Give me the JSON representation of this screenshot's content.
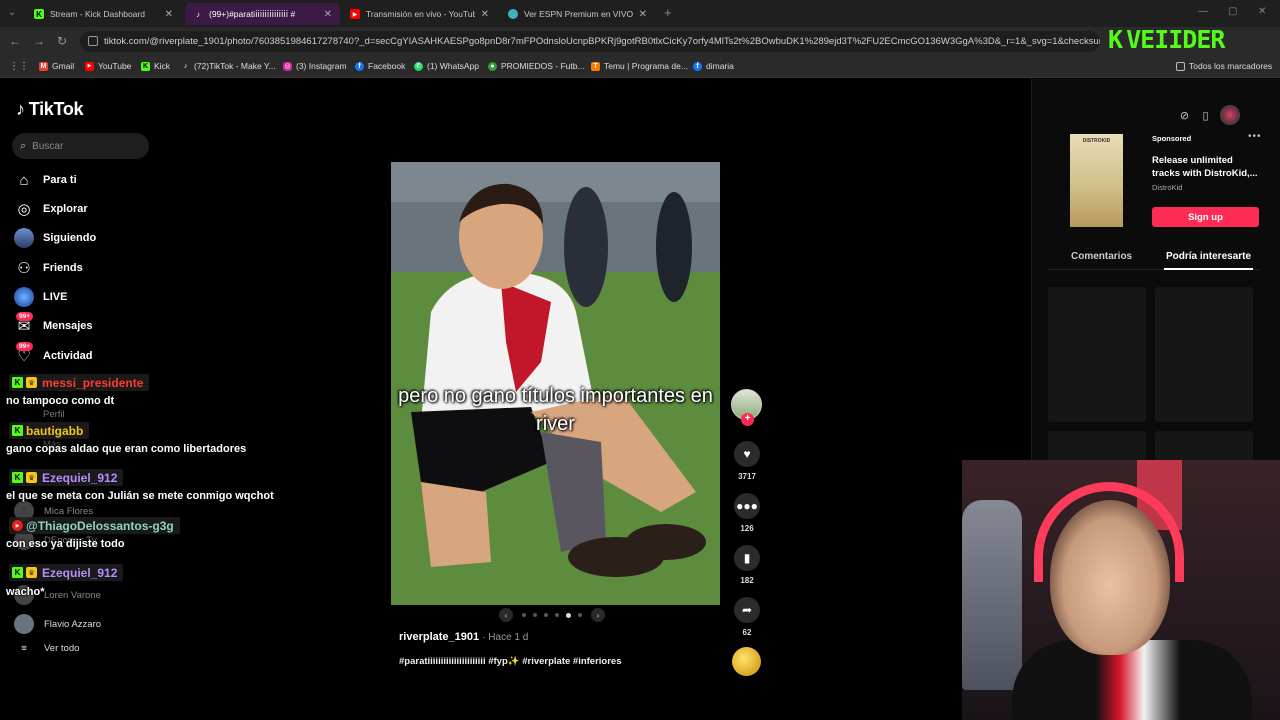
{
  "browser": {
    "tabs": [
      {
        "title": "Stream - Kick Dashboard",
        "icon": "kick-icon",
        "color": "#53fc18"
      },
      {
        "title": "(99+)#parati𝗂𝗂𝗂𝗂𝗂𝗂𝗂𝗂𝗂𝗂𝗂𝗂𝗂𝗂 #",
        "icon": "tiktok-icon",
        "color": "#ffffff"
      },
      {
        "title": "Transmisión en vivo - YouTube",
        "icon": "youtube-icon",
        "color": "#ff0000"
      },
      {
        "title": "Ver ESPN Premium en VIVO Gr",
        "icon": "globe-icon",
        "color": "#3fb1c1"
      }
    ],
    "url": "tiktok.com/@riverplate_1901/photo/7603851984617278740?_d=secCgYIASAHKAESPgo8pnD8r7mFPOdnsloUcnpBPKRj9gotRB0tlxCicKy7orfy4MlTs2t%2BOwbuDK1%289ejd3T%2FU2ECmcGO136W3GgA%3D&_r=1&_svg=1&checksum=c...",
    "bookmarks": [
      {
        "label": "Gmail",
        "icon": "gmail-icon",
        "color": "#ea4335"
      },
      {
        "label": "YouTube",
        "icon": "youtube-icon",
        "color": "#ff0000"
      },
      {
        "label": "Kick",
        "icon": "kick-icon",
        "color": "#53fc18"
      },
      {
        "label": "(72)TikTok - Make Y...",
        "icon": "tiktok-icon",
        "color": "#ffffff"
      },
      {
        "label": "(3) Instagram",
        "icon": "instagram-icon",
        "color": "#d6249f"
      },
      {
        "label": "Facebook",
        "icon": "facebook-icon",
        "color": "#1877f2"
      },
      {
        "label": "(1) WhatsApp",
        "icon": "whatsapp-icon",
        "color": "#25d366"
      },
      {
        "label": "PROMIEDOS - Futb...",
        "icon": "promiedos-icon",
        "color": "#2e9e3a"
      },
      {
        "label": "Temu | Programa de...",
        "icon": "temu-icon",
        "color": "#fb7701"
      },
      {
        "label": "dimaria",
        "icon": "facebook-icon",
        "color": "#1877f2"
      }
    ],
    "all_bookmarks": "Todos los marcadores"
  },
  "kick_overlay": {
    "k": "K",
    "name": "VEIIDER"
  },
  "tiktok": {
    "logo": "TikTok",
    "search_placeholder": "Buscar",
    "nav": {
      "for_you": "Para ti",
      "explore": "Explorar",
      "following": "Siguiendo",
      "friends": "Friends",
      "live": "LIVE",
      "messages": "Mensajes",
      "activity": "Actividad",
      "profile": "Perfil",
      "more": "Más",
      "badge": "99+"
    },
    "following_accounts": [
      "Mica Flores",
      "DEportes Tv",
      "Loren Varone",
      "Flavio Azzaro"
    ],
    "see_all": "Ver todo",
    "post": {
      "caption": "pero no gano títulos importantes en river",
      "author": "riverplate_1901",
      "time": "· Hace 1 d",
      "hashtags": "#paratiiiiiiiiiiiiiiiiiiiiii #fyp✨ #riverplate #inferiores",
      "likes": "3717",
      "comments": "126",
      "saves": "182",
      "shares": "62",
      "carousel_active_index": 4,
      "carousel_total": 6
    },
    "right_panel": {
      "sponsored": "Sponsored",
      "ad_brand": "DISTROKID",
      "ad_title": "Release unlimited tracks with DistroKid,...",
      "ad_sub": "DistroKid",
      "signup": "Sign up",
      "tab_comments": "Comentarios",
      "tab_interest": "Podría interesarte"
    }
  },
  "chat": [
    {
      "user": "messi_presidente",
      "color": "#ff3b30",
      "message": "no tampoco como dt"
    },
    {
      "user": "bautigabb",
      "color": "#f5c518",
      "message": "gano copas aldao que eran como libertadores"
    },
    {
      "user": "Ezequiel_912",
      "color": "#b98cff",
      "message": "el que se meta con Julián se mete conmigo wqchot"
    },
    {
      "user": "@ThiagoDelossantos-g3g",
      "color": "#8fd3c6",
      "message": "con eso ya dijiste todo"
    },
    {
      "user": "Ezequiel_912",
      "color": "#b98cff",
      "message": "wacho*"
    }
  ]
}
